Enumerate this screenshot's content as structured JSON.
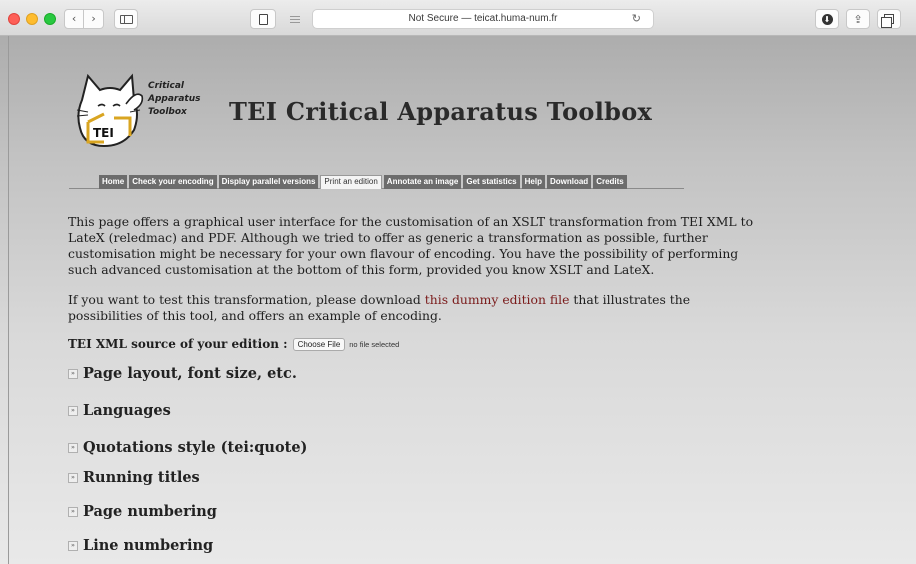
{
  "browser": {
    "nav_back": "‹",
    "nav_forward": "›",
    "url_text": "Not Secure — teicat.huma-num.fr",
    "reload_glyph": "↻",
    "download_glyph": "⬇",
    "share_glyph": "⇪",
    "icons": [
      "back-icon",
      "forward-icon",
      "sidebar-icon",
      "page-icon",
      "reader-icon",
      "reload-icon",
      "download-icon",
      "share-icon",
      "tabs-icon"
    ]
  },
  "logo": {
    "line1": "Critical",
    "line2": "Apparatus",
    "line3": "Toolbox",
    "badge": "TEI"
  },
  "site": {
    "title": "TEI Critical Apparatus Toolbox"
  },
  "menu": {
    "items": [
      {
        "label": "Home",
        "active": false
      },
      {
        "label": "Check your encoding",
        "active": false
      },
      {
        "label": "Display parallel versions",
        "active": false
      },
      {
        "label": "Print an edition",
        "active": true
      },
      {
        "label": "Annotate an image",
        "active": false
      },
      {
        "label": "Get statistics",
        "active": false
      },
      {
        "label": "Help",
        "active": false
      },
      {
        "label": "Download",
        "active": false
      },
      {
        "label": "Credits",
        "active": false
      }
    ]
  },
  "content": {
    "intro_paragraph": "This page offers a graphical user interface for the customisation of an XSLT transformation from TEI XML to LateX (reledmac) and PDF. Although we tried to offer as generic a transformation as possible, further customisation might be necessary for your own flavour of encoding. You have the possibility of performing such advanced customisation at the bottom of this form, provided you know XSLT and LateX.",
    "test_before": "If you want to test this transformation, please download ",
    "test_link": "this dummy edition file",
    "test_after": " that illustrates the possibilities of this tool, and offers an example of encoding.",
    "upload_label": "TEI XML source of your edition :",
    "choose_file": "Choose File",
    "no_file": "no file selected",
    "toggle_glyph": "»",
    "sections": [
      "Page layout, font size, etc.",
      "Languages",
      "Quotations style (tei:quote)",
      "Running titles",
      "Page numbering",
      "Line numbering"
    ]
  },
  "colors": {
    "menu_bg": "#6c6c6c",
    "link": "#7a1a1a",
    "logo_gold": "#d9a521"
  }
}
